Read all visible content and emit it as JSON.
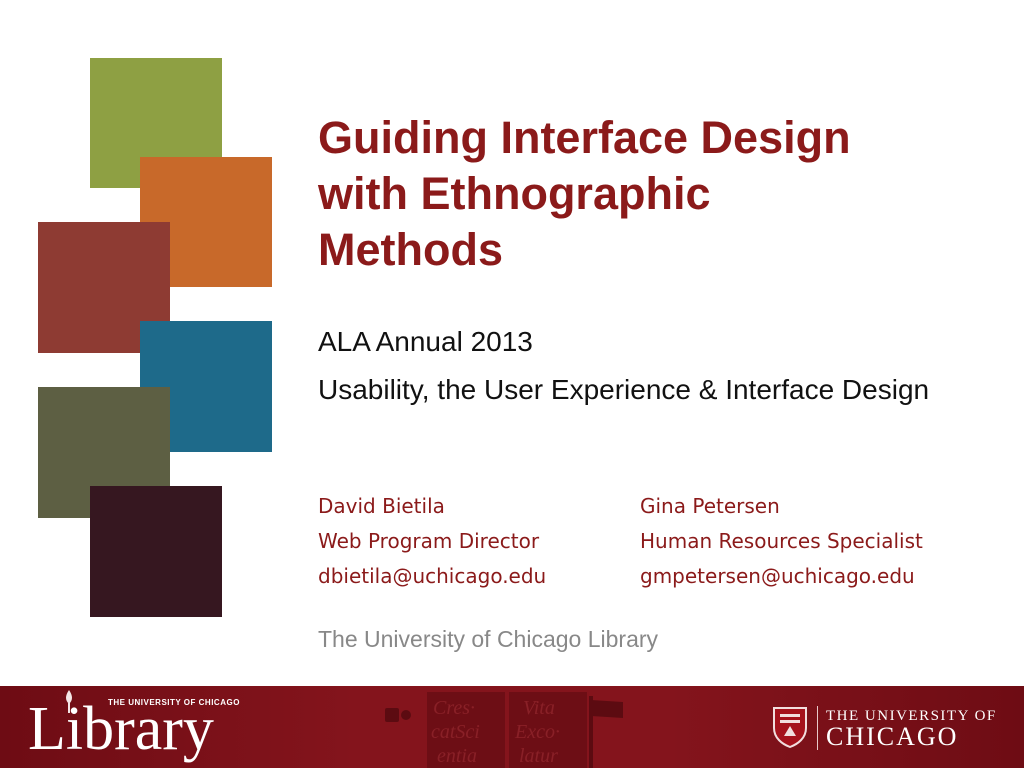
{
  "colors": {
    "accent": "#8b1a1a",
    "footer": "#7d1018",
    "square_green": "#8ea043",
    "square_orange": "#c8692a",
    "square_red": "#8e3b33",
    "square_teal": "#1e6a8a",
    "square_olive": "#5d5f43",
    "square_plum": "#361720"
  },
  "slide": {
    "title_lines": [
      "Guiding Interface Design",
      "with Ethnographic",
      "Methods"
    ],
    "subtitle_1": "ALA Annual 2013",
    "subtitle_2": "Usability, the User Experience & Interface Design",
    "presenters": [
      {
        "name": "David Bietila",
        "role": "Web Program Director",
        "email": "dbietila@uchicago.edu"
      },
      {
        "name": "Gina Petersen",
        "role": "Human Resources Specialist",
        "email": "gmpetersen@uchicago.edu"
      }
    ],
    "organization": "The University of Chicago Library"
  },
  "footer": {
    "library_logo_small": "THE UNIVERSITY OF CHICAGO",
    "library_logo_word": "Library",
    "motto_lines": [
      "Cres-",
      "catSci",
      "entia",
      "Vita",
      "Exco-",
      "latur"
    ],
    "university_logo_top": "THE UNIVERSITY OF",
    "university_logo_bottom": "CHICAGO"
  }
}
